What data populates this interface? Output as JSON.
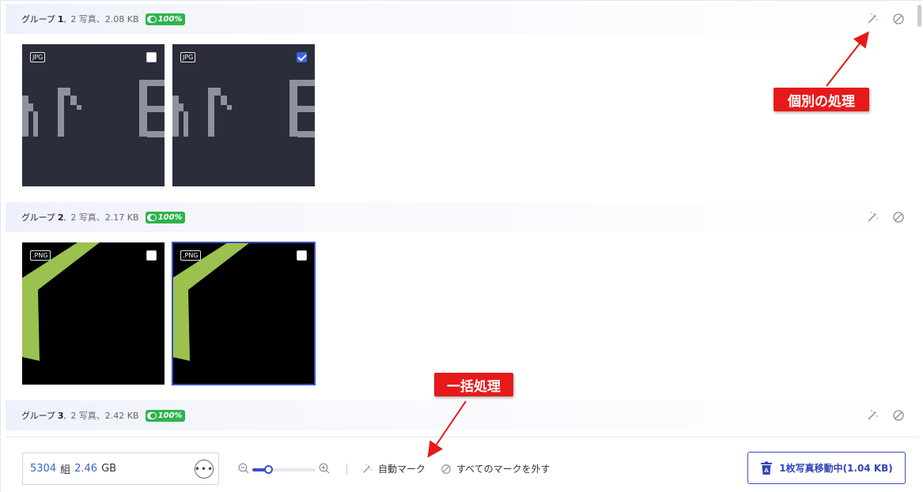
{
  "groups": [
    {
      "label": "グループ",
      "number": "1",
      "meta": "2 写真、2.08 KB",
      "similarity": "100%",
      "photos": [
        {
          "format": "JPG",
          "checked": false
        },
        {
          "format": "JPG",
          "checked": true
        }
      ]
    },
    {
      "label": "グループ",
      "number": "2",
      "meta": "2 写真、2.17 KB",
      "similarity": "100%",
      "photos": [
        {
          "format": ".PNG",
          "checked": false
        },
        {
          "format": ".PNG",
          "checked": false
        }
      ]
    },
    {
      "label": "グループ",
      "number": "3",
      "meta": "2 写真、2.42 KB",
      "similarity": "100%",
      "photos": []
    }
  ],
  "callouts": {
    "individual": "個別の処理",
    "batch": "一括処理"
  },
  "footer": {
    "groups_count": "5304",
    "groups_unit": "組",
    "total_size": "2.46",
    "size_unit": "GB",
    "more_label": "•••",
    "zoom_level": 0.25,
    "auto_mark_label": "自動マーク",
    "unmark_all_label": "すべてのマークを外す",
    "move_button_label": "1枚写真移動中(1.04 KB)"
  },
  "colors": {
    "accent": "#3b4fc4",
    "badge": "#2eb34d",
    "callout": "#e61a1a",
    "count_text": "#3b63c9"
  },
  "icons": {
    "auto_process": "magic-wand-icon",
    "ignore": "ban-icon",
    "more": "ellipsis-icon",
    "zoom_out": "zoom-out-icon",
    "zoom_in": "zoom-in-icon",
    "move": "recycle-bin-icon"
  }
}
